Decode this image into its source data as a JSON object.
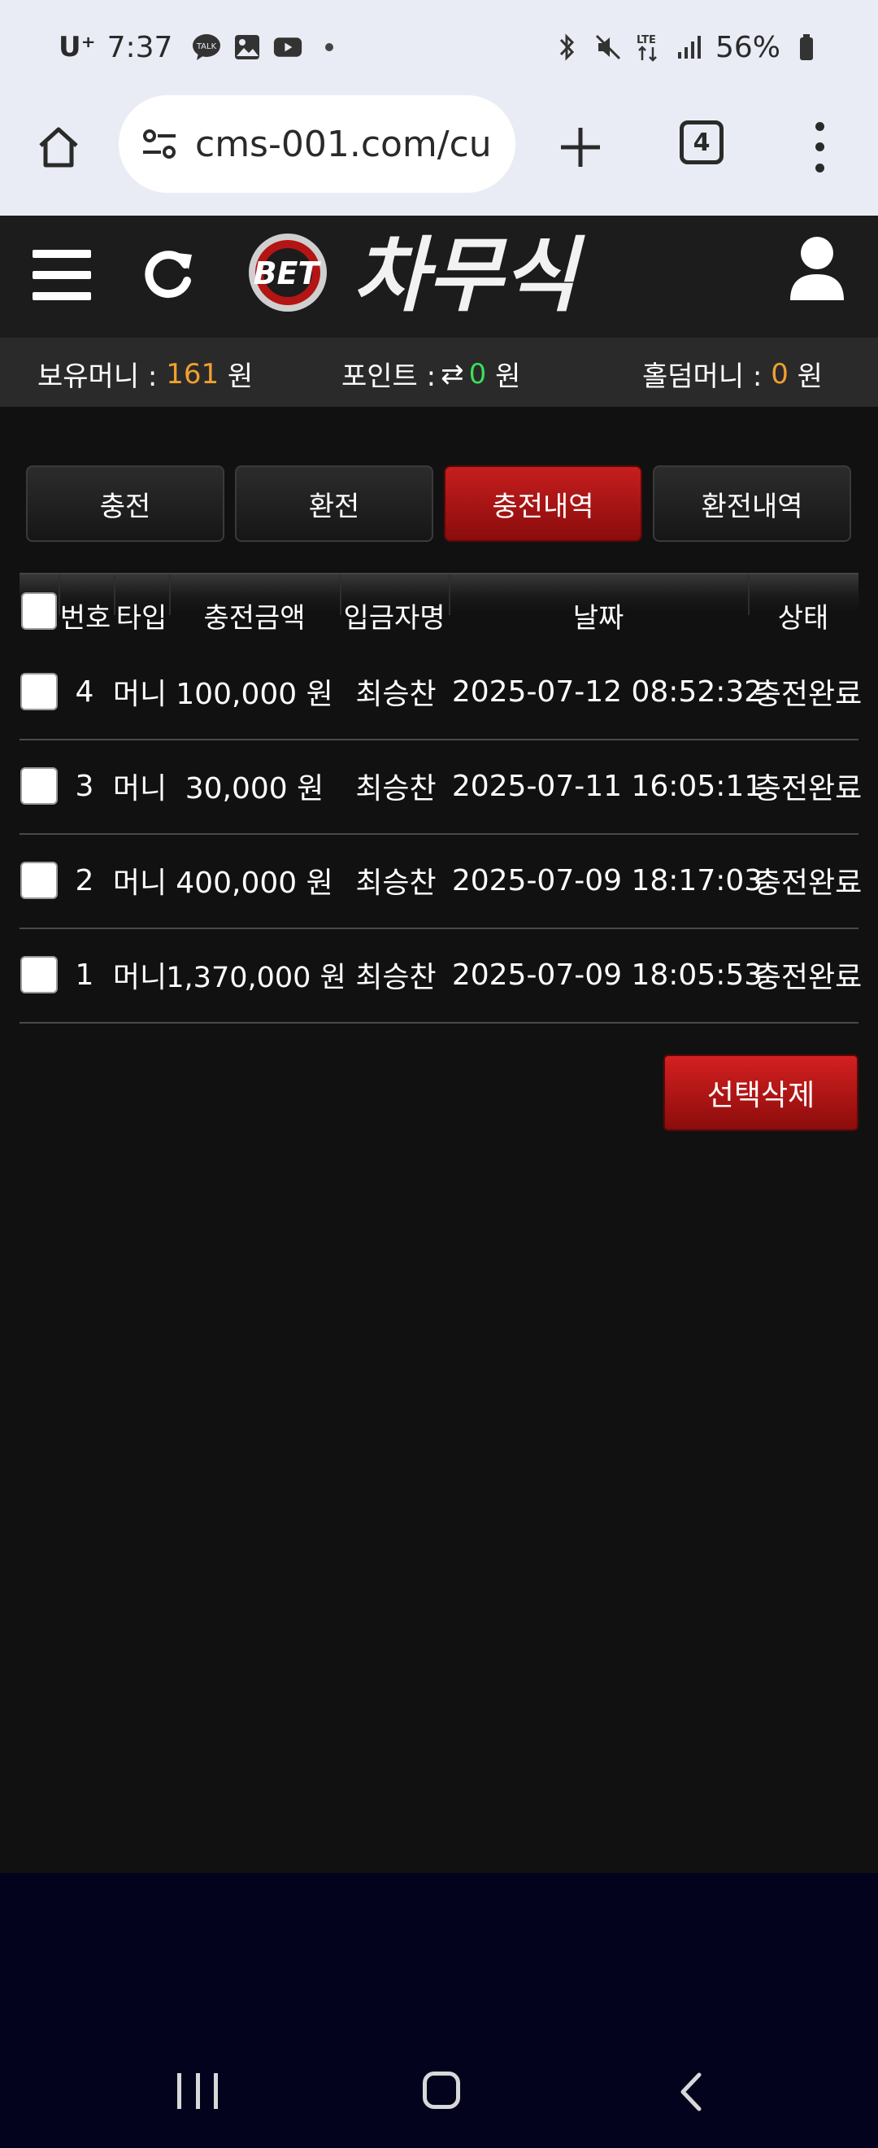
{
  "status_bar": {
    "carrier": "U⁺",
    "time": "7:37",
    "battery": "56%"
  },
  "browser": {
    "url": "cms-001.com/cu",
    "tab_count": "4"
  },
  "balances": {
    "money_label": "보유머니 :",
    "money_value": "161",
    "money_unit": "원",
    "point_label": "포인트 :",
    "point_value": "0",
    "point_unit": "원",
    "holdem_label": "홀덤머니 :",
    "holdem_value": "0",
    "holdem_unit": "원"
  },
  "tabs": [
    {
      "label": "충전",
      "active": false
    },
    {
      "label": "환전",
      "active": false
    },
    {
      "label": "충전내역",
      "active": true
    },
    {
      "label": "환전내역",
      "active": false
    }
  ],
  "table": {
    "headers": [
      "번호",
      "타입",
      "충전금액",
      "입금자명",
      "날짜",
      "상태"
    ],
    "rows": [
      {
        "no": "4",
        "type": "머니",
        "amount": "100,000 원",
        "name": "최승찬",
        "date": "2025-07-12 08:52:32",
        "status": "충전완료"
      },
      {
        "no": "3",
        "type": "머니",
        "amount": "30,000 원",
        "name": "최승찬",
        "date": "2025-07-11 16:05:11",
        "status": "충전완료"
      },
      {
        "no": "2",
        "type": "머니",
        "amount": "400,000 원",
        "name": "최승찬",
        "date": "2025-07-09 18:17:03",
        "status": "충전완료"
      },
      {
        "no": "1",
        "type": "머니",
        "amount": "1,370,000 원",
        "name": "최승찬",
        "date": "2025-07-09 18:05:53",
        "status": "충전완료"
      }
    ]
  },
  "actions": {
    "delete_selected": "선택삭제"
  },
  "logo": {
    "small": "BET",
    "main": "차무식"
  },
  "colors": {
    "accent_red": "#b01414",
    "money_orange": "#f0a030",
    "point_green": "#3ddc5a"
  }
}
